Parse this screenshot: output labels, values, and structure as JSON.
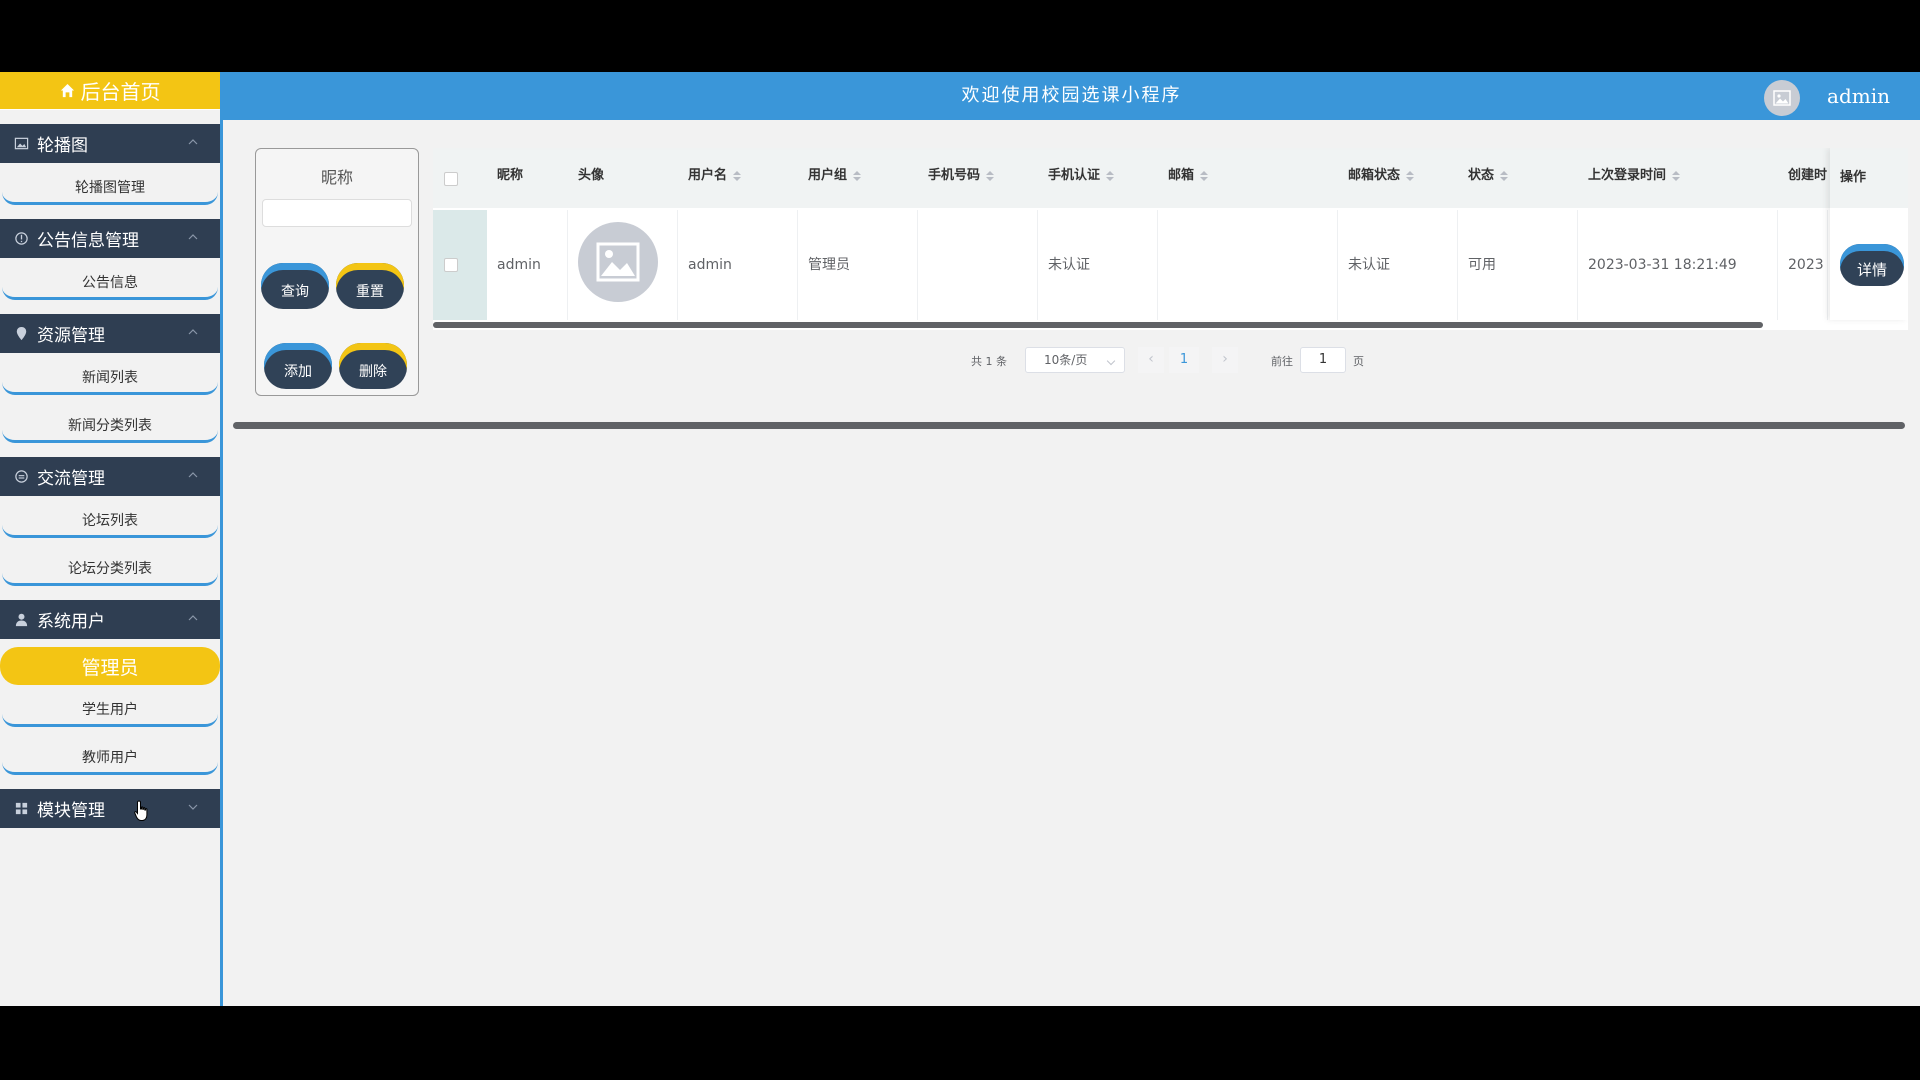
{
  "sidebar": {
    "home": "后台首页",
    "menus": [
      {
        "title": "轮播图",
        "items": [
          "轮播图管理"
        ]
      },
      {
        "title": "公告信息管理",
        "items": [
          "公告信息"
        ]
      },
      {
        "title": "资源管理",
        "items": [
          "新闻列表",
          "新闻分类列表"
        ]
      },
      {
        "title": "交流管理",
        "items": [
          "论坛列表",
          "论坛分类列表"
        ]
      },
      {
        "title": "系统用户",
        "items": [
          "管理员",
          "学生用户",
          "教师用户"
        ]
      },
      {
        "title": "模块管理",
        "items": []
      }
    ]
  },
  "header": {
    "title": "欢迎使用校园选课小程序",
    "username": "admin"
  },
  "search": {
    "label": "昵称",
    "query_btn": "查询",
    "reset_btn": "重置",
    "add_btn": "添加",
    "delete_btn": "删除"
  },
  "table": {
    "columns": [
      "昵称",
      "头像",
      "用户名",
      "用户组",
      "手机号码",
      "手机认证",
      "邮箱",
      "邮箱状态",
      "状态",
      "上次登录时间",
      "创建时",
      "操作"
    ],
    "rows": [
      {
        "nickname": "admin",
        "username": "admin",
        "group": "管理员",
        "phone": "",
        "phone_auth": "未认证",
        "email": "",
        "email_status": "未认证",
        "status": "可用",
        "last_login": "2023-03-31 18:21:49",
        "created": "2023",
        "detail": "详情"
      }
    ]
  },
  "pager": {
    "total": "共 1 条",
    "page_size": "10条/页",
    "prev": "‹",
    "current": "1",
    "next": "›",
    "goto_label": "前往",
    "goto_value": "1",
    "page_label": "页"
  },
  "colors": {
    "accent_blue": "#3a96d9",
    "accent_yellow": "#f3c514",
    "sidebar_dark": "#2f3e52"
  }
}
